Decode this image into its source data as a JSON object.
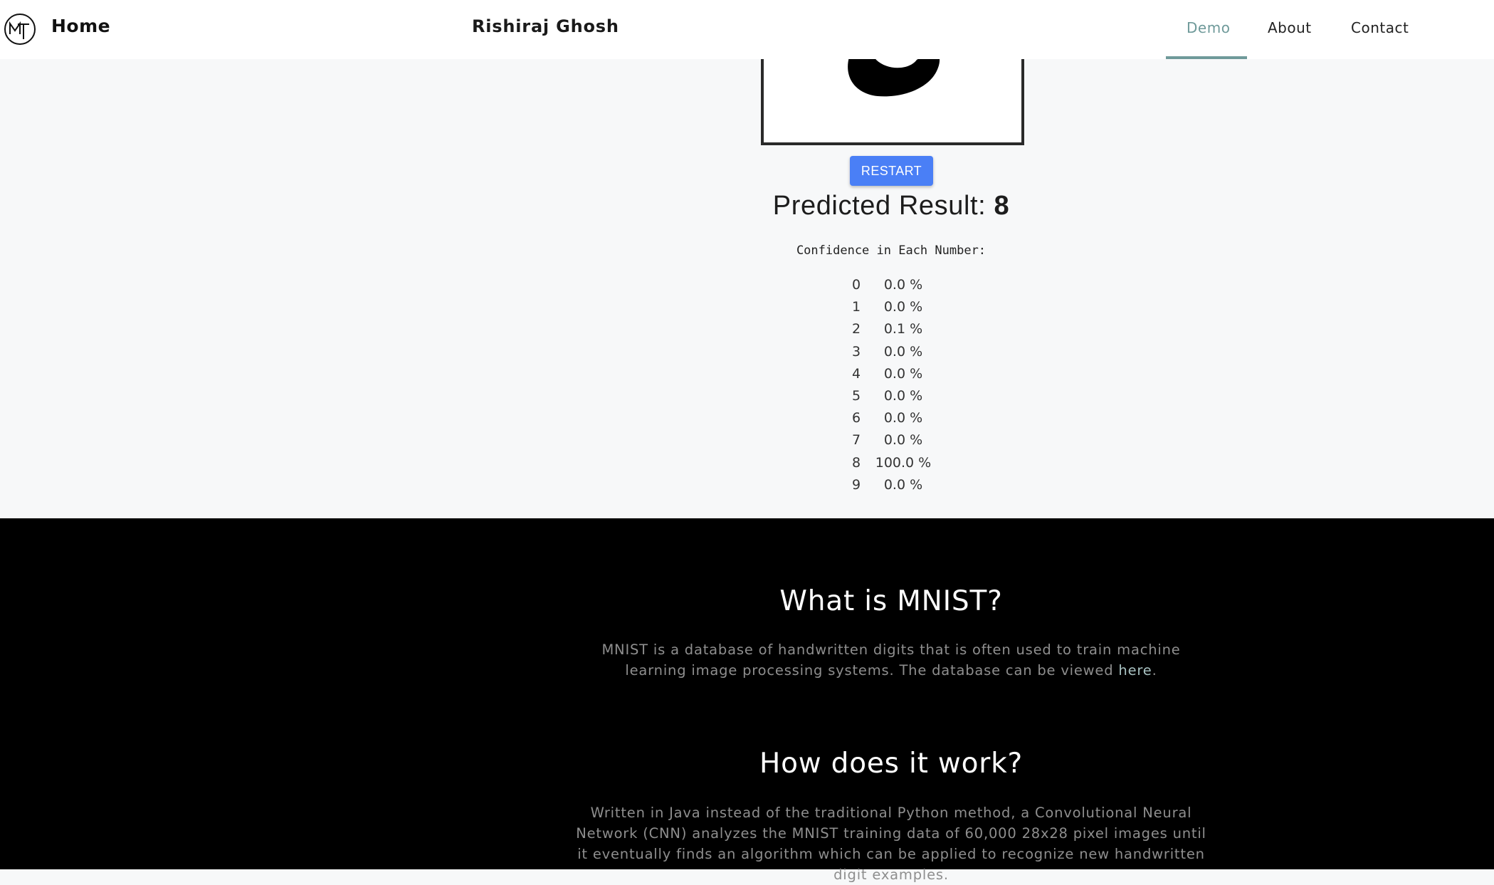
{
  "nav": {
    "brand": "Home",
    "center_title": "Rishiraj Ghosh",
    "links": [
      {
        "label": "Demo",
        "active": true
      },
      {
        "label": "About",
        "active": false
      },
      {
        "label": "Contact",
        "active": false
      }
    ],
    "accent_color": "#6f9a9a"
  },
  "demo": {
    "restart_label": "RESTART",
    "predicted_label": "Predicted Result:",
    "predicted_value": "8",
    "confidence_label": "Confidence in Each Number:",
    "confidence": [
      {
        "digit": "0",
        "value": "0.0 %"
      },
      {
        "digit": "1",
        "value": "0.0 %"
      },
      {
        "digit": "2",
        "value": "0.1 %"
      },
      {
        "digit": "3",
        "value": "0.0 %"
      },
      {
        "digit": "4",
        "value": "0.0 %"
      },
      {
        "digit": "5",
        "value": "0.0 %"
      },
      {
        "digit": "6",
        "value": "0.0 %"
      },
      {
        "digit": "7",
        "value": "0.0 %"
      },
      {
        "digit": "8",
        "value": "100.0 %"
      },
      {
        "digit": "9",
        "value": "0.0 %"
      }
    ],
    "button_color": "#4a7ff6"
  },
  "info": {
    "mnist_heading": "What is MNIST?",
    "mnist_text": "MNIST is a database of handwritten digits that is often used to train machine learning image processing systems. The database can be viewed",
    "mnist_link": "here",
    "how_heading": "How does it work?",
    "how_text": "Written in Java instead of the traditional Python method, a Convolutional Neural Network (CNN) analyzes the MNIST training data of 60,000 28x28 pixel images until it eventually finds an algorithm which can be applied to recognize new handwritten digit examples."
  }
}
